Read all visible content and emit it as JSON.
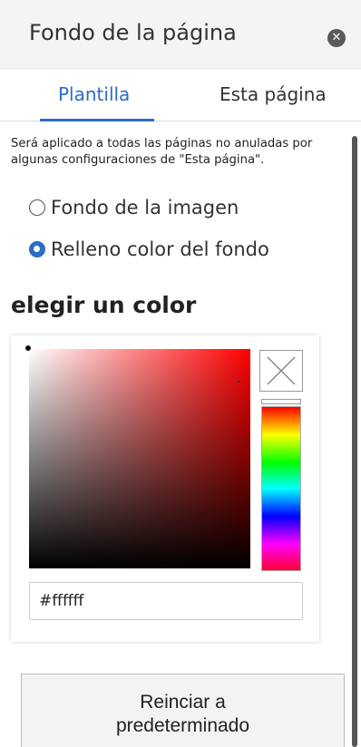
{
  "panel": {
    "title": "Fondo de la página",
    "close_icon": "close-circle-icon"
  },
  "tabs": [
    {
      "label": "Plantilla",
      "active": true
    },
    {
      "label": "Esta página",
      "active": false
    }
  ],
  "description": "Será aplicado a todas las páginas no anuladas por algunas configuraciones de \"Esta página\".",
  "background_options": [
    {
      "label": "Fondo de la imagen",
      "checked": false
    },
    {
      "label": "Relleno color del fondo",
      "checked": true
    }
  ],
  "color_section": {
    "title": "elegir un color",
    "hex_value": "#ffffff",
    "hue_color": "#ff0000",
    "clear_icon": "x-icon"
  },
  "reset_button": {
    "line1": "Reinciar a",
    "line2": "predeterminado"
  },
  "colors": {
    "accent": "#2b6cc4"
  }
}
